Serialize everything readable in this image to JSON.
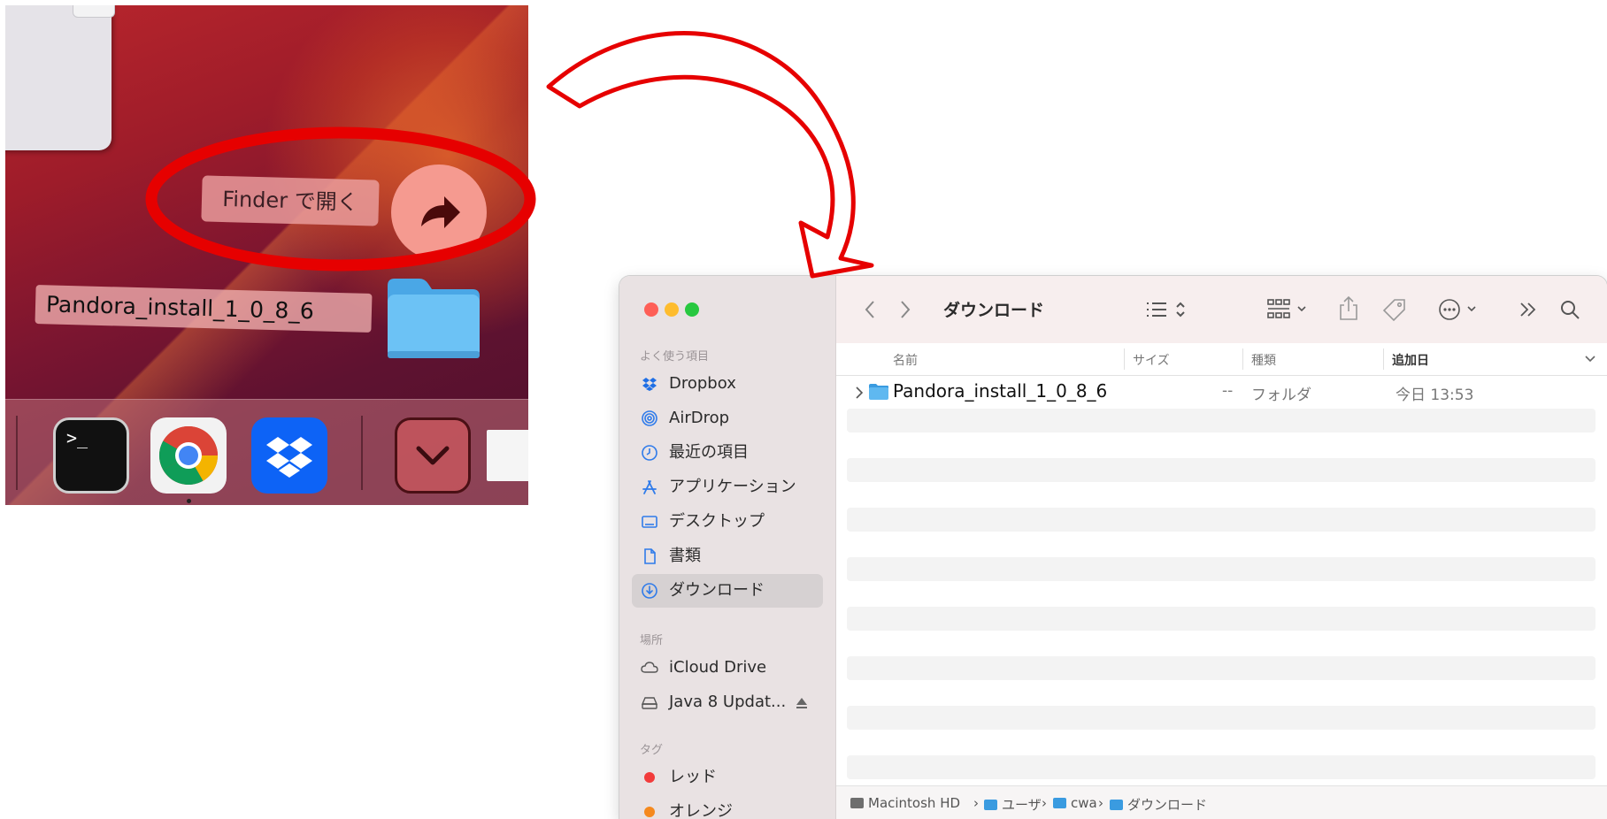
{
  "desktop": {
    "context_menu_label": "Finder で開く",
    "share_icon": "share-arrow-icon",
    "desktop_file_label": "Pandora_install_1_0_8_6",
    "dock": {
      "apps": [
        "terminal-icon",
        "chrome-icon",
        "dropbox-icon",
        "downloads-stack-icon"
      ],
      "terminal_prompt": ">_"
    }
  },
  "annotation": {
    "highlight_color": "#e60000"
  },
  "finder": {
    "window_controls": {
      "close": "#fe5f57",
      "minimize": "#febc2e",
      "zoom": "#28c840"
    },
    "sidebar": {
      "favorites_heading": "よく使う項目",
      "favorites": [
        {
          "label": "Dropbox",
          "icon": "dropbox-icon"
        },
        {
          "label": "AirDrop",
          "icon": "airdrop-icon"
        },
        {
          "label": "最近の項目",
          "icon": "clock-icon"
        },
        {
          "label": "アプリケーション",
          "icon": "apps-icon"
        },
        {
          "label": "デスクトップ",
          "icon": "desktop-icon"
        },
        {
          "label": "書類",
          "icon": "document-icon"
        },
        {
          "label": "ダウンロード",
          "icon": "download-icon"
        }
      ],
      "locations_heading": "場所",
      "locations": [
        {
          "label": "iCloud Drive",
          "icon": "cloud-icon"
        },
        {
          "label": "Java 8 Updat...",
          "icon": "disk-icon"
        }
      ],
      "tags_heading": "タグ",
      "tags": [
        {
          "label": "レッド",
          "color": "#f23b3b"
        },
        {
          "label": "オレンジ",
          "color": "#f5891e"
        }
      ]
    },
    "toolbar": {
      "title": "ダウンロード"
    },
    "columns": {
      "name": "名前",
      "size": "サイズ",
      "kind": "種類",
      "added": "追加日"
    },
    "files": [
      {
        "name": "Pandora_install_1_0_8_6",
        "size": "--",
        "kind": "フォルダ",
        "added": "今日 13:53"
      }
    ],
    "path_bar": [
      "Macintosh HD",
      "ユーザ",
      "cwa",
      "ダウンロード"
    ]
  }
}
